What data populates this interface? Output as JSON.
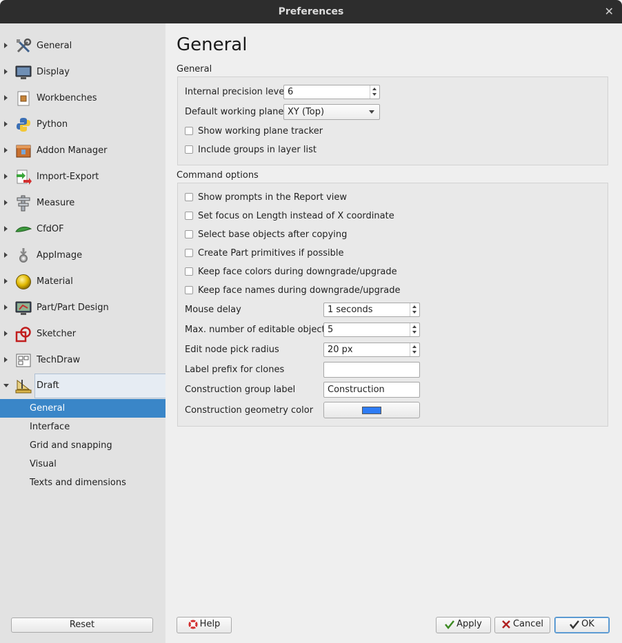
{
  "window": {
    "title": "Preferences"
  },
  "sidebar": {
    "items": [
      {
        "label": "General",
        "icon": "tools-icon"
      },
      {
        "label": "Display",
        "icon": "monitor-icon"
      },
      {
        "label": "Workbenches",
        "icon": "workbench-icon"
      },
      {
        "label": "Python",
        "icon": "python-icon"
      },
      {
        "label": "Addon Manager",
        "icon": "addon-manager-icon"
      },
      {
        "label": "Import-Export",
        "icon": "import-export-icon"
      },
      {
        "label": "Measure",
        "icon": "caliper-icon"
      },
      {
        "label": "CfdOF",
        "icon": "cfdof-icon"
      },
      {
        "label": "AppImage",
        "icon": "appimage-icon"
      },
      {
        "label": "Material",
        "icon": "material-sphere-icon"
      },
      {
        "label": "Part/Part Design",
        "icon": "part-design-icon"
      },
      {
        "label": "Sketcher",
        "icon": "sketcher-icon"
      },
      {
        "label": "TechDraw",
        "icon": "techdraw-icon"
      },
      {
        "label": "Draft",
        "icon": "draft-icon"
      }
    ],
    "draft_subitems": [
      "General",
      "Interface",
      "Grid and snapping",
      "Visual",
      "Texts and dimensions"
    ],
    "active_subitem": "General",
    "reset_label": "Reset"
  },
  "page": {
    "title": "General",
    "general_section": {
      "label": "General",
      "precision_label": "Internal precision level",
      "precision_value": "6",
      "working_plane_label": "Default working plane",
      "working_plane_value": "XY (Top)",
      "show_tracker": "Show working plane tracker",
      "include_groups": "Include groups in layer list"
    },
    "command_section": {
      "label": "Command options",
      "checks": [
        "Show prompts in the Report view",
        "Set focus on Length instead of X coordinate",
        "Select base objects after copying",
        "Create Part primitives if possible",
        "Keep face colors during downgrade/upgrade",
        "Keep face names during downgrade/upgrade"
      ],
      "mouse_delay_label": "Mouse delay",
      "mouse_delay_value": "1 seconds",
      "max_editable_label": "Max. number of editable objects",
      "max_editable_value": "5",
      "pick_radius_label": "Edit node pick radius",
      "pick_radius_value": "20 px",
      "clone_prefix_label": "Label prefix for clones",
      "clone_prefix_value": "",
      "construction_group_label": "Construction group label",
      "construction_group_value": "Construction",
      "construction_color_label": "Construction geometry color",
      "construction_color": "#2e7cf6"
    }
  },
  "footer": {
    "help": "Help",
    "apply": "Apply",
    "cancel": "Cancel",
    "ok": "OK"
  },
  "colors": {
    "selection": "#3a86c8",
    "titlebar": "#2d2d2d"
  }
}
